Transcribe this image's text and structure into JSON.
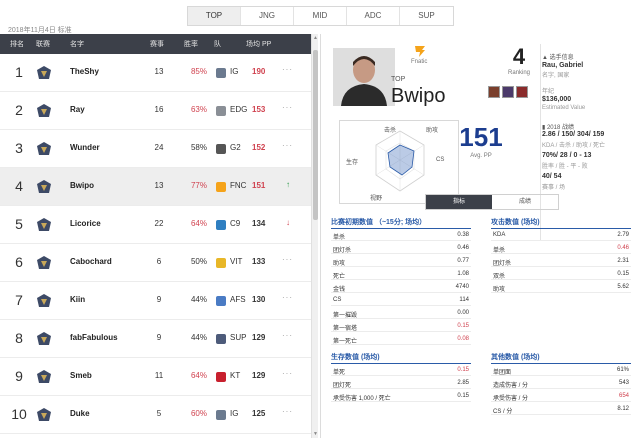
{
  "tabs": [
    "TOP",
    "JNG",
    "MID",
    "ADC",
    "SUP"
  ],
  "active_tab": "TOP",
  "date": "2018年11月4日 标准",
  "columns": [
    "排名",
    "联赛",
    "名字",
    "赛事",
    "胜率",
    "队",
    "场均 PP"
  ],
  "rows": [
    {
      "rank": "1",
      "name": "TheShy",
      "games": "13",
      "winrate": "85%",
      "team": "IG",
      "pp": "190",
      "wr_color": "hi",
      "pp_color": "red",
      "trend": "···"
    },
    {
      "rank": "2",
      "name": "Ray",
      "games": "16",
      "winrate": "63%",
      "team": "EDG",
      "pp": "153",
      "wr_color": "hi",
      "pp_color": "red",
      "trend": "···"
    },
    {
      "rank": "3",
      "name": "Wunder",
      "games": "24",
      "winrate": "58%",
      "team": "G2",
      "pp": "152",
      "wr_color": "lo",
      "pp_color": "red",
      "trend": "···"
    },
    {
      "rank": "4",
      "name": "Bwipo",
      "games": "13",
      "winrate": "77%",
      "team": "FNC",
      "pp": "151",
      "wr_color": "hi",
      "pp_color": "red",
      "trend": "↑"
    },
    {
      "rank": "5",
      "name": "Licorice",
      "games": "22",
      "winrate": "64%",
      "team": "C9",
      "pp": "134",
      "wr_color": "hi",
      "pp_color": "dark",
      "trend": "↓"
    },
    {
      "rank": "6",
      "name": "Cabochard",
      "games": "6",
      "winrate": "50%",
      "team": "VIT",
      "pp": "133",
      "wr_color": "lo",
      "pp_color": "dark",
      "trend": "···"
    },
    {
      "rank": "7",
      "name": "Kiin",
      "games": "9",
      "winrate": "44%",
      "team": "AFS",
      "pp": "130",
      "wr_color": "lo",
      "pp_color": "dark",
      "trend": "···"
    },
    {
      "rank": "8",
      "name": "fabFabulous",
      "games": "9",
      "winrate": "44%",
      "team": "SUP",
      "pp": "129",
      "wr_color": "lo",
      "pp_color": "dark",
      "trend": "···"
    },
    {
      "rank": "9",
      "name": "Smeb",
      "games": "11",
      "winrate": "64%",
      "team": "KT",
      "pp": "129",
      "wr_color": "hi",
      "pp_color": "dark",
      "trend": "···"
    },
    {
      "rank": "10",
      "name": "Duke",
      "games": "5",
      "winrate": "60%",
      "team": "IG",
      "pp": "125",
      "wr_color": "hi",
      "pp_color": "dark",
      "trend": "···"
    }
  ],
  "player": {
    "team_name": "Fnatic",
    "role": "TOP",
    "name": "Bwipo",
    "rank": "4",
    "rank_label": "Ranking",
    "info_title": "选手信息",
    "realname": "Rau, Gabriel",
    "realname_label": "名字, 国家",
    "age_label": "年纪",
    "value": "$136,000",
    "value_label": "Estimated Value",
    "season_label": "2018 战绩",
    "kda": "2.86 / 150/ 304/ 159",
    "kda_label": "KDA / 击杀 / 助攻 / 死亡",
    "winrate": "70%/ 28 / 0 - 13",
    "winrate_label": "胜率 / 胜 - 平 - 败",
    "games": "40/ 54",
    "games_label": "赛事 / 场",
    "avg_pp": "151",
    "avg_pp_label": "Avg. PP",
    "radar_labels": [
      "击杀",
      "助攻",
      "CS",
      "目标",
      "视野",
      "生存"
    ]
  },
  "subtabs": [
    "指标",
    "成绩"
  ],
  "active_subtab": "指标",
  "sections": {
    "laning": {
      "title": "比赛初期数值 （~15分; 场均）",
      "rows": [
        {
          "label": "单杀",
          "value": "0.38",
          "red": false
        },
        {
          "label": "团灯杀",
          "value": "0.46",
          "red": false
        },
        {
          "label": "助攻",
          "value": "0.77",
          "red": false
        },
        {
          "label": "死亡",
          "value": "1.08",
          "red": false
        },
        {
          "label": "金钱",
          "value": "4740",
          "red": false
        },
        {
          "label": "CS",
          "value": "114",
          "red": false
        },
        {
          "label": "第一摧毁",
          "value": "0.00",
          "red": false
        },
        {
          "label": "第一宿塔",
          "value": "0.15",
          "red": true
        },
        {
          "label": "第一死亡",
          "value": "0.08",
          "red": true
        }
      ]
    },
    "attack": {
      "title": "攻击数值 (场均)",
      "rows": [
        {
          "label": "KDA",
          "value": "2.79",
          "red": false
        },
        {
          "label": "单杀",
          "value": "0.46",
          "red": true
        },
        {
          "label": "团灯杀",
          "value": "2.31",
          "red": false
        },
        {
          "label": "双杀",
          "value": "0.15",
          "red": false
        },
        {
          "label": "助攻",
          "value": "5.62",
          "red": false
        }
      ]
    },
    "survival": {
      "title": "生存数值 (场均)",
      "rows": [
        {
          "label": "单死",
          "value": "0.15",
          "red": true
        },
        {
          "label": "团灯死",
          "value": "2.85",
          "red": false
        },
        {
          "label": "承受伤害 1,000 / 死亡",
          "value": "0.15",
          "red": false
        }
      ]
    },
    "other": {
      "title": "其他数值 (场均)",
      "rows": [
        {
          "label": "单团面",
          "value": "61%",
          "red": false
        },
        {
          "label": "造成伤害 / 分",
          "value": "543",
          "red": false
        },
        {
          "label": "承受伤害 / 分",
          "value": "654",
          "red": true
        },
        {
          "label": "CS / 分",
          "value": "8.12",
          "red": false
        }
      ]
    }
  }
}
